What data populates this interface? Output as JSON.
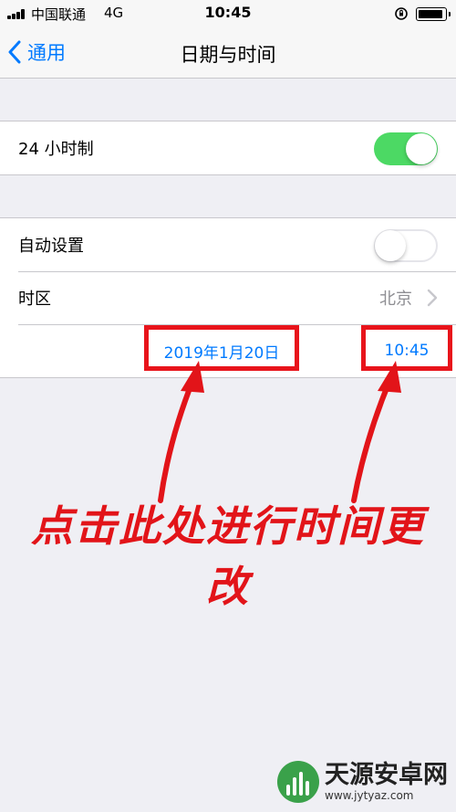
{
  "status_bar": {
    "carrier": "中国联通",
    "network": "4G",
    "time": "10:45",
    "battery_level": 0.9
  },
  "nav": {
    "back_label": "通用",
    "title": "日期与时间"
  },
  "settings": {
    "hour24": {
      "label": "24 小时制",
      "on": true
    },
    "auto_set": {
      "label": "自动设置",
      "on": false
    },
    "timezone": {
      "label": "时区",
      "value": "北京"
    },
    "date": "2019年1月20日",
    "time": "10:45"
  },
  "annotation": {
    "text": "点击此处进行时间更改",
    "color": "#e8141b"
  },
  "watermark": {
    "name": "天源安卓网",
    "url": "www.jytyaz.com"
  },
  "colors": {
    "accent": "#007aff",
    "toggle_on": "#4cd964",
    "background": "#efeff4"
  }
}
